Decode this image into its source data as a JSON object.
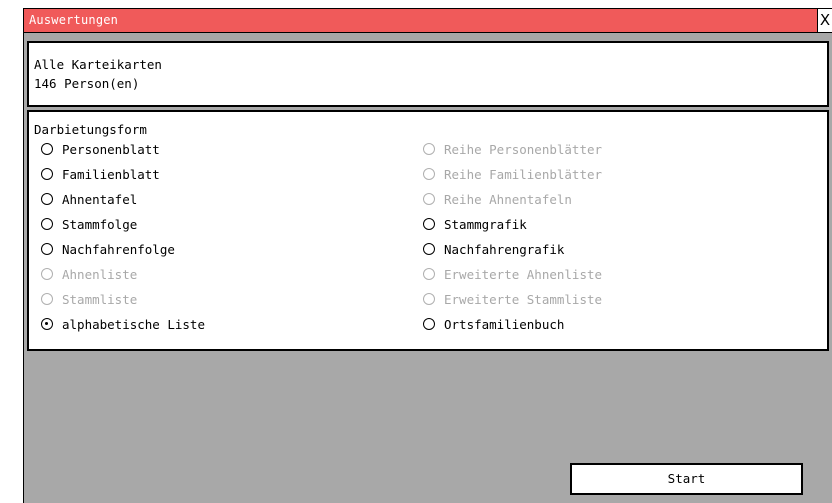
{
  "window": {
    "title": "Auswertungen",
    "close_label": "X"
  },
  "info": {
    "line1": "Alle Karteikarten",
    "line2": "146 Person(en)"
  },
  "form": {
    "title": "Darbietungsform",
    "left_options": [
      {
        "label": "Personenblatt",
        "enabled": true,
        "selected": false
      },
      {
        "label": "Familienblatt",
        "enabled": true,
        "selected": false
      },
      {
        "label": "Ahnentafel",
        "enabled": true,
        "selected": false
      },
      {
        "label": "Stammfolge",
        "enabled": true,
        "selected": false
      },
      {
        "label": "Nachfahrenfolge",
        "enabled": true,
        "selected": false
      },
      {
        "label": "Ahnenliste",
        "enabled": false,
        "selected": false
      },
      {
        "label": "Stammliste",
        "enabled": false,
        "selected": false
      },
      {
        "label": "alphabetische Liste",
        "enabled": true,
        "selected": true
      }
    ],
    "right_options": [
      {
        "label": "Reihe Personenblätter",
        "enabled": false,
        "selected": false
      },
      {
        "label": "Reihe Familienblätter",
        "enabled": false,
        "selected": false
      },
      {
        "label": "Reihe Ahnentafeln",
        "enabled": false,
        "selected": false
      },
      {
        "label": "Stammgrafik",
        "enabled": true,
        "selected": false
      },
      {
        "label": "Nachfahrengrafik",
        "enabled": true,
        "selected": false
      },
      {
        "label": "Erweiterte Ahnenliste",
        "enabled": false,
        "selected": false
      },
      {
        "label": "Erweiterte Stammliste",
        "enabled": false,
        "selected": false
      },
      {
        "label": "Ortsfamilienbuch",
        "enabled": true,
        "selected": false
      }
    ]
  },
  "actions": {
    "start_label": "Start"
  },
  "colors": {
    "titlebar": "#f05a5a",
    "window_bg": "#a8a8a8",
    "disabled_text": "#a8a8a8"
  }
}
